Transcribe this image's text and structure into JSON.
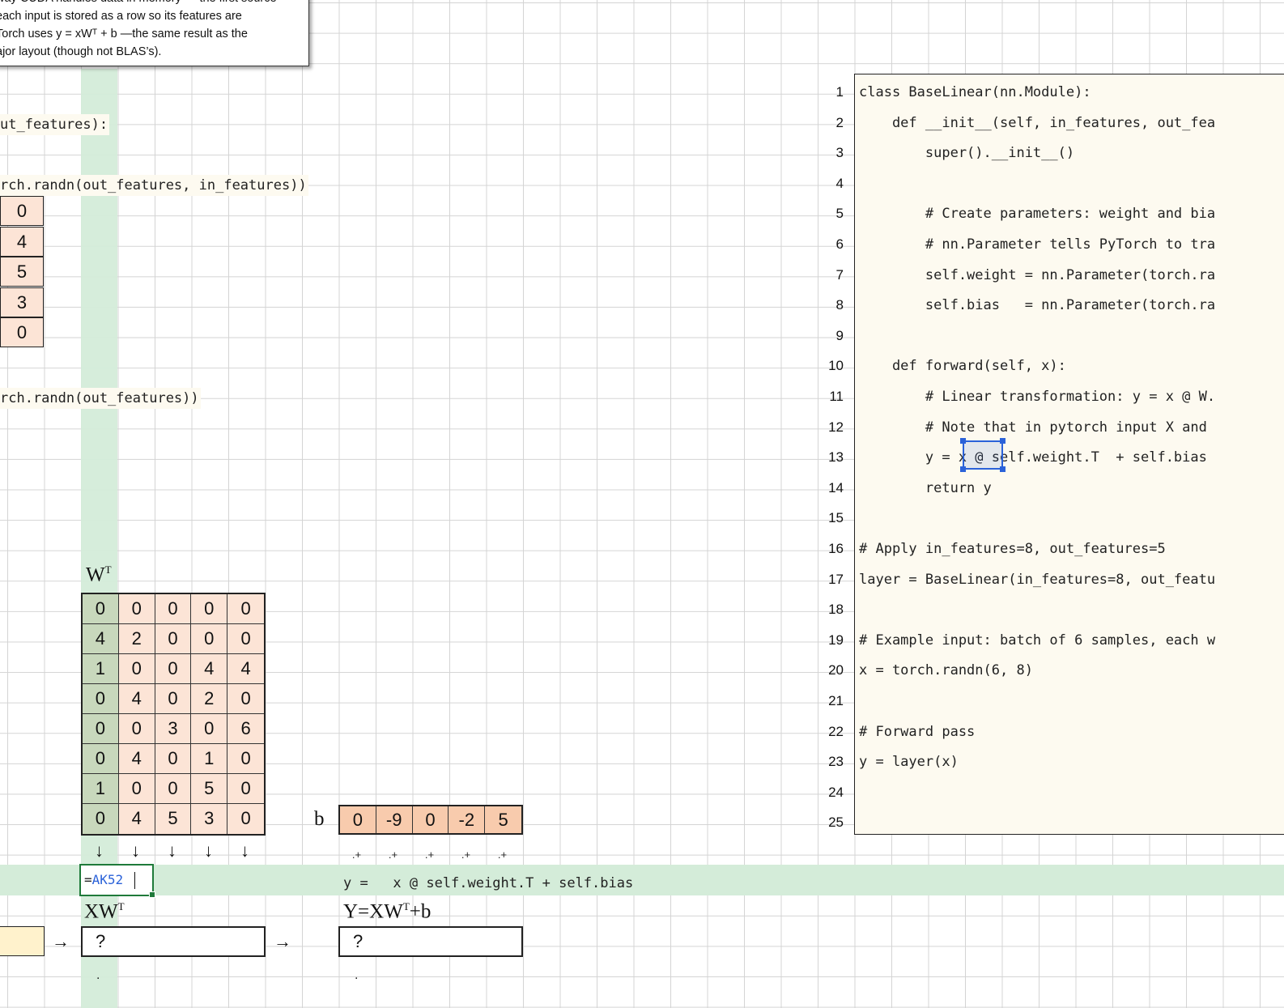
{
  "note": {
    "lines": [
      "way CUDA handles data in memory — the first source",
      "each input is stored as a row so its features are",
      "Torch uses y = xWᵀ + b —the same result as the",
      "ajor layout (though not BLAS’s)."
    ]
  },
  "left_code": {
    "line1": "ut_features):",
    "line2": "rch.randn(out_features, in_features))",
    "line3": "rch.randn(out_features))"
  },
  "w_column": [
    "0",
    "4",
    "5",
    "3",
    "0"
  ],
  "wt": {
    "label": "W",
    "sup": "T",
    "rows": [
      [
        "0",
        "0",
        "0",
        "0",
        "0"
      ],
      [
        "4",
        "2",
        "0",
        "0",
        "0"
      ],
      [
        "1",
        "0",
        "0",
        "4",
        "4"
      ],
      [
        "0",
        "4",
        "0",
        "2",
        "0"
      ],
      [
        "0",
        "0",
        "3",
        "0",
        "6"
      ],
      [
        "0",
        "4",
        "0",
        "1",
        "0"
      ],
      [
        "1",
        "0",
        "0",
        "5",
        "0"
      ],
      [
        "0",
        "4",
        "5",
        "3",
        "0"
      ]
    ]
  },
  "b": {
    "label": "b",
    "values": [
      "0",
      "-9",
      "0",
      "-2",
      "5"
    ]
  },
  "arrows": [
    "↓",
    "↓",
    "↓",
    "↓",
    "↓"
  ],
  "dotplus": [
    ".+",
    ".+",
    ".+",
    ".+",
    ".+"
  ],
  "formula_cell": {
    "eq": "=",
    "ref": "AK52"
  },
  "formula_text": "y =   x @ self.weight.T + self.bias",
  "xwt": {
    "label": "XW",
    "sup": "T",
    "value": "?"
  },
  "y_out": {
    "label": "Y=XW",
    "sup": "T",
    "suffix": "+b",
    "value": "?"
  },
  "right_arrows": [
    "→",
    "→"
  ],
  "dots": [
    ".",
    "."
  ],
  "editor": {
    "line_numbers": [
      "1",
      "2",
      "3",
      "4",
      "5",
      "6",
      "7",
      "8",
      "9",
      "10",
      "11",
      "12",
      "13",
      "14",
      "15",
      "16",
      "17",
      "18",
      "19",
      "20",
      "21",
      "22",
      "23",
      "24",
      "25"
    ],
    "lines": [
      "class BaseLinear(nn.Module):",
      "    def __init__(self, in_features, out_fea",
      "        super().__init__()",
      "",
      "        # Create parameters: weight and bia",
      "        # nn.Parameter tells PyTorch to tra",
      "        self.weight = nn.Parameter(torch.ra",
      "        self.bias   = nn.Parameter(torch.ra",
      "",
      "    def forward(self, x):",
      "        # Linear transformation: y = x @ W.",
      "        # Note that in pytorch input X and ",
      "        y = x @ self.weight.T  + self.bias",
      "        return y",
      "",
      "# Apply in_features=8, out_features=5",
      "layer = BaseLinear(in_features=8, out_featu",
      "",
      "# Example input: batch of 6 samples, each w",
      "x = torch.randn(6, 8)",
      "",
      "# Forward pass",
      "y = layer(x)",
      "",
      ""
    ]
  }
}
